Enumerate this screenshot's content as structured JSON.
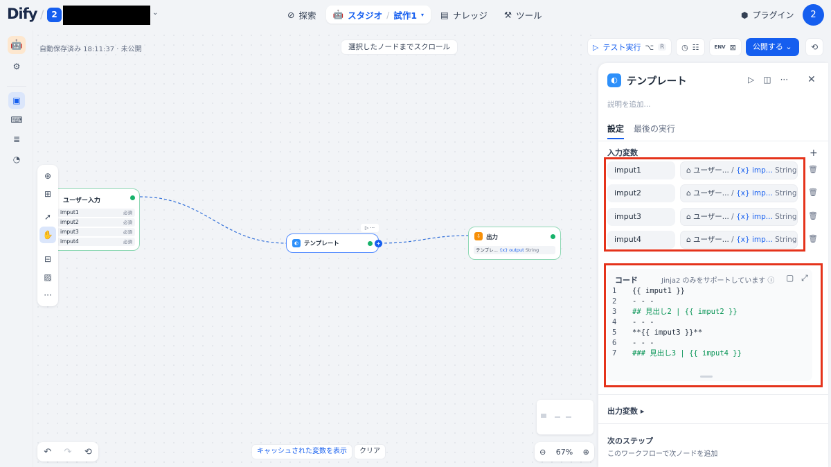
{
  "topbar": {
    "logo": "Dify",
    "workspace_badge": "2",
    "nav": {
      "explore": "探索",
      "studio": "スタジオ",
      "app_name": "試作1",
      "knowledge": "ナレッジ",
      "tools": "ツール"
    },
    "plugin": "プラグイン",
    "avatar": "2"
  },
  "canvas": {
    "autosave": "自動保存済み 18:11:37 · 未公開",
    "scroll_to_node": "選択したノードまでスクロール",
    "cached_vars": "キャッシュされた変数を表示",
    "clear": "クリア",
    "zoom": "67%"
  },
  "nodes": {
    "start": {
      "title": "ユーザー入力",
      "vars": [
        {
          "name": "imput1",
          "req": "必須"
        },
        {
          "name": "imput2",
          "req": "必須"
        },
        {
          "name": "imput3",
          "req": "必須"
        },
        {
          "name": "imput4",
          "req": "必須"
        }
      ]
    },
    "template": {
      "title": "テンプレート"
    },
    "output": {
      "title": "出力",
      "row_src": "テンプレ...",
      "row_var": "{x} output",
      "row_type": "String"
    }
  },
  "toolbar": {
    "test_run": "テスト実行",
    "shortcut_alt": "⌥",
    "shortcut_key": "R",
    "env": "ENV",
    "publish": "公開する"
  },
  "panel": {
    "title": "テンプレート",
    "description_placeholder": "説明を追加...",
    "tabs": {
      "settings": "設定",
      "last_run": "最後の実行"
    },
    "input_vars_label": "入力変数",
    "input_vars": [
      {
        "name": "imput1",
        "src": "ユーザー...",
        "var": "{x} imp...",
        "type": "String"
      },
      {
        "name": "imput2",
        "src": "ユーザー...",
        "var": "{x} imp...",
        "type": "String"
      },
      {
        "name": "imput3",
        "src": "ユーザー...",
        "var": "{x} imp...",
        "type": "String"
      },
      {
        "name": "imput4",
        "src": "ユーザー...",
        "var": "{x} imp...",
        "type": "String"
      }
    ],
    "code": {
      "label": "コード",
      "note": "Jinja2 のみをサポートしています ⓘ",
      "lines": [
        {
          "num": "1",
          "text": "{{ imput1 }}",
          "style": "c"
        },
        {
          "num": "2",
          "text": "- - -",
          "style": "c"
        },
        {
          "num": "3",
          "text": "## 見出し2 | {{ imput2 }}",
          "style": "g"
        },
        {
          "num": "4",
          "text": "- - -",
          "style": "c"
        },
        {
          "num": "5",
          "text": "**{{ imput3 }}**",
          "style": "c"
        },
        {
          "num": "6",
          "text": "- - -",
          "style": "c"
        },
        {
          "num": "7",
          "text": "### 見出し3 | {{ imput4 }}",
          "style": "g"
        }
      ]
    },
    "output_vars_label": "出力変数 ▸",
    "next_step_label": "次のステップ",
    "next_step_sub": "このワークフローで次ノードを追加"
  },
  "colors": {
    "accent": "#155eef",
    "success": "#17b26a",
    "highlight": "#e5331b"
  }
}
